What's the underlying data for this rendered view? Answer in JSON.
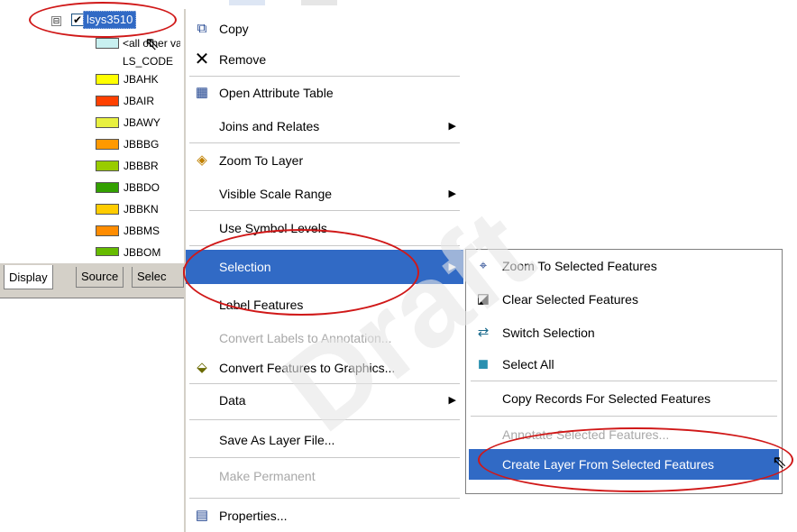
{
  "toc": {
    "layer_name": "lsys3510",
    "expander_glyph": "⊟",
    "check_glyph": "✔",
    "all_other_label": "<all other values>",
    "field_label": "LS_CODE",
    "classes": [
      {
        "label": "JBAHK",
        "color": "#ffff00"
      },
      {
        "label": "JBAIR",
        "color": "#ff4000"
      },
      {
        "label": "JBAWY",
        "color": "#e8f040"
      },
      {
        "label": "JBBBG",
        "color": "#ff9900"
      },
      {
        "label": "JBBBR",
        "color": "#99cc00"
      },
      {
        "label": "JBBDO",
        "color": "#33a000"
      },
      {
        "label": "JBBKN",
        "color": "#ffcc00"
      },
      {
        "label": "JBBMS",
        "color": "#ff8c00"
      },
      {
        "label": "JBBOM",
        "color": "#66bb00"
      }
    ],
    "tabs": [
      "Display",
      "Source",
      "Selec"
    ]
  },
  "menu": {
    "items": [
      {
        "label": "Copy",
        "icon": "copy-icon"
      },
      {
        "label": "Remove",
        "icon": "remove-icon"
      },
      {
        "label": "Open Attribute Table",
        "icon": "table-icon"
      },
      {
        "label": "Joins and Relates"
      },
      {
        "label": "Zoom To Layer",
        "icon": "zoom-layer-icon"
      },
      {
        "label": "Visible Scale Range"
      },
      {
        "label": "Use Symbol Levels"
      },
      {
        "label": "Selection"
      },
      {
        "label": "Label Features"
      },
      {
        "label": "Convert Labels to Annotation..."
      },
      {
        "label": "Convert Features to Graphics...",
        "icon": "convert-graphics-icon"
      },
      {
        "label": "Data"
      },
      {
        "label": "Save As Layer File..."
      },
      {
        "label": "Make Permanent"
      },
      {
        "label": "Properties...",
        "icon": "properties-icon"
      }
    ],
    "arrow_glyph": "▶"
  },
  "submenu": {
    "items": [
      {
        "label": "Zoom To Selected Features",
        "icon": "zoom-selected-icon"
      },
      {
        "label": "Clear Selected Features",
        "icon": "clear-selection-icon"
      },
      {
        "label": "Switch Selection",
        "icon": "switch-selection-icon"
      },
      {
        "label": "Select All",
        "icon": "select-all-icon"
      },
      {
        "label": "Copy Records For Selected Features"
      },
      {
        "label": "Annotate Selected Features..."
      },
      {
        "label": "Create Layer From Selected Features"
      }
    ]
  },
  "watermark": "Draft",
  "colors": {
    "highlight": "#316ac5",
    "disabled_text": "#a8a8a8",
    "annotation_red": "#d01818"
  }
}
